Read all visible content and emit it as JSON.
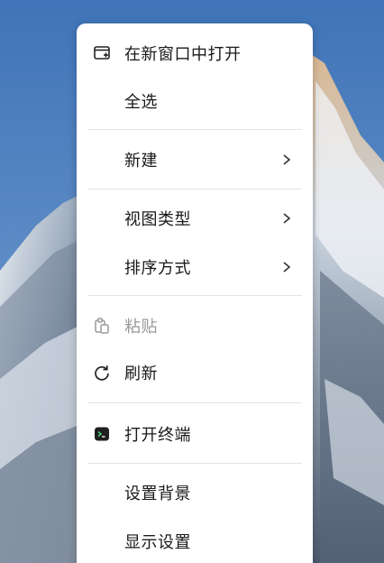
{
  "menu": {
    "items": [
      {
        "label": "在新窗口中打开",
        "icon": "new-window-icon"
      },
      {
        "label": "全选"
      },
      {
        "label": "新建",
        "submenu": true
      },
      {
        "label": "视图类型",
        "submenu": true
      },
      {
        "label": "排序方式",
        "submenu": true
      },
      {
        "label": "粘贴",
        "icon": "paste-icon",
        "disabled": true
      },
      {
        "label": "刷新",
        "icon": "refresh-icon"
      },
      {
        "label": "打开终端",
        "icon": "terminal-icon"
      },
      {
        "label": "设置背景"
      },
      {
        "label": "显示设置"
      }
    ]
  },
  "colors": {
    "menu_background": "#ffffff",
    "text": "#1a1a1a",
    "disabled_text": "#9a9a9a",
    "separator": "#e3e3e3"
  }
}
